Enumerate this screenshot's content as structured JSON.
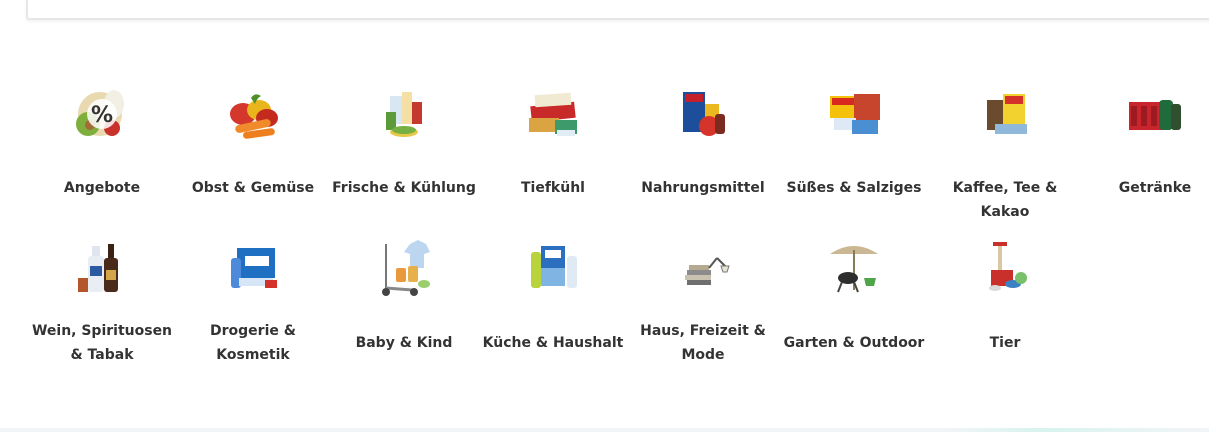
{
  "categories_row1": [
    {
      "label": "Angebote",
      "icon": "percent-icon"
    },
    {
      "label": "Obst & Gemüse",
      "icon": "vegetables-icon"
    },
    {
      "label": "Frische & Kühlung",
      "icon": "fresh-products-icon"
    },
    {
      "label": "Tiefkühl",
      "icon": "frozen-food-icon"
    },
    {
      "label": "Nahrungsmittel",
      "icon": "groceries-icon"
    },
    {
      "label": "Süßes & Salziges",
      "icon": "snacks-icon"
    },
    {
      "label": "Kaffee, Tee & Kakao",
      "icon": "coffee-icon"
    },
    {
      "label": "Getränke",
      "icon": "drinks-crate-icon"
    }
  ],
  "categories_row2": [
    {
      "label": "Wein, Spirituosen\n& Tabak",
      "icon": "wine-bottles-icon"
    },
    {
      "label": "Drogerie &\nKosmetik",
      "icon": "drugstore-icon"
    },
    {
      "label": "Baby & Kind",
      "icon": "baby-icon"
    },
    {
      "label": "Küche & Haushalt",
      "icon": "cleaning-icon"
    },
    {
      "label": "Haus, Freizeit &\nMode",
      "icon": "lamp-books-icon"
    },
    {
      "label": "Garten & Outdoor",
      "icon": "garden-umbrella-icon"
    },
    {
      "label": "Tier",
      "icon": "pet-icon"
    }
  ],
  "colors": {
    "text": "#333333",
    "divider": "#e7e7e7"
  }
}
